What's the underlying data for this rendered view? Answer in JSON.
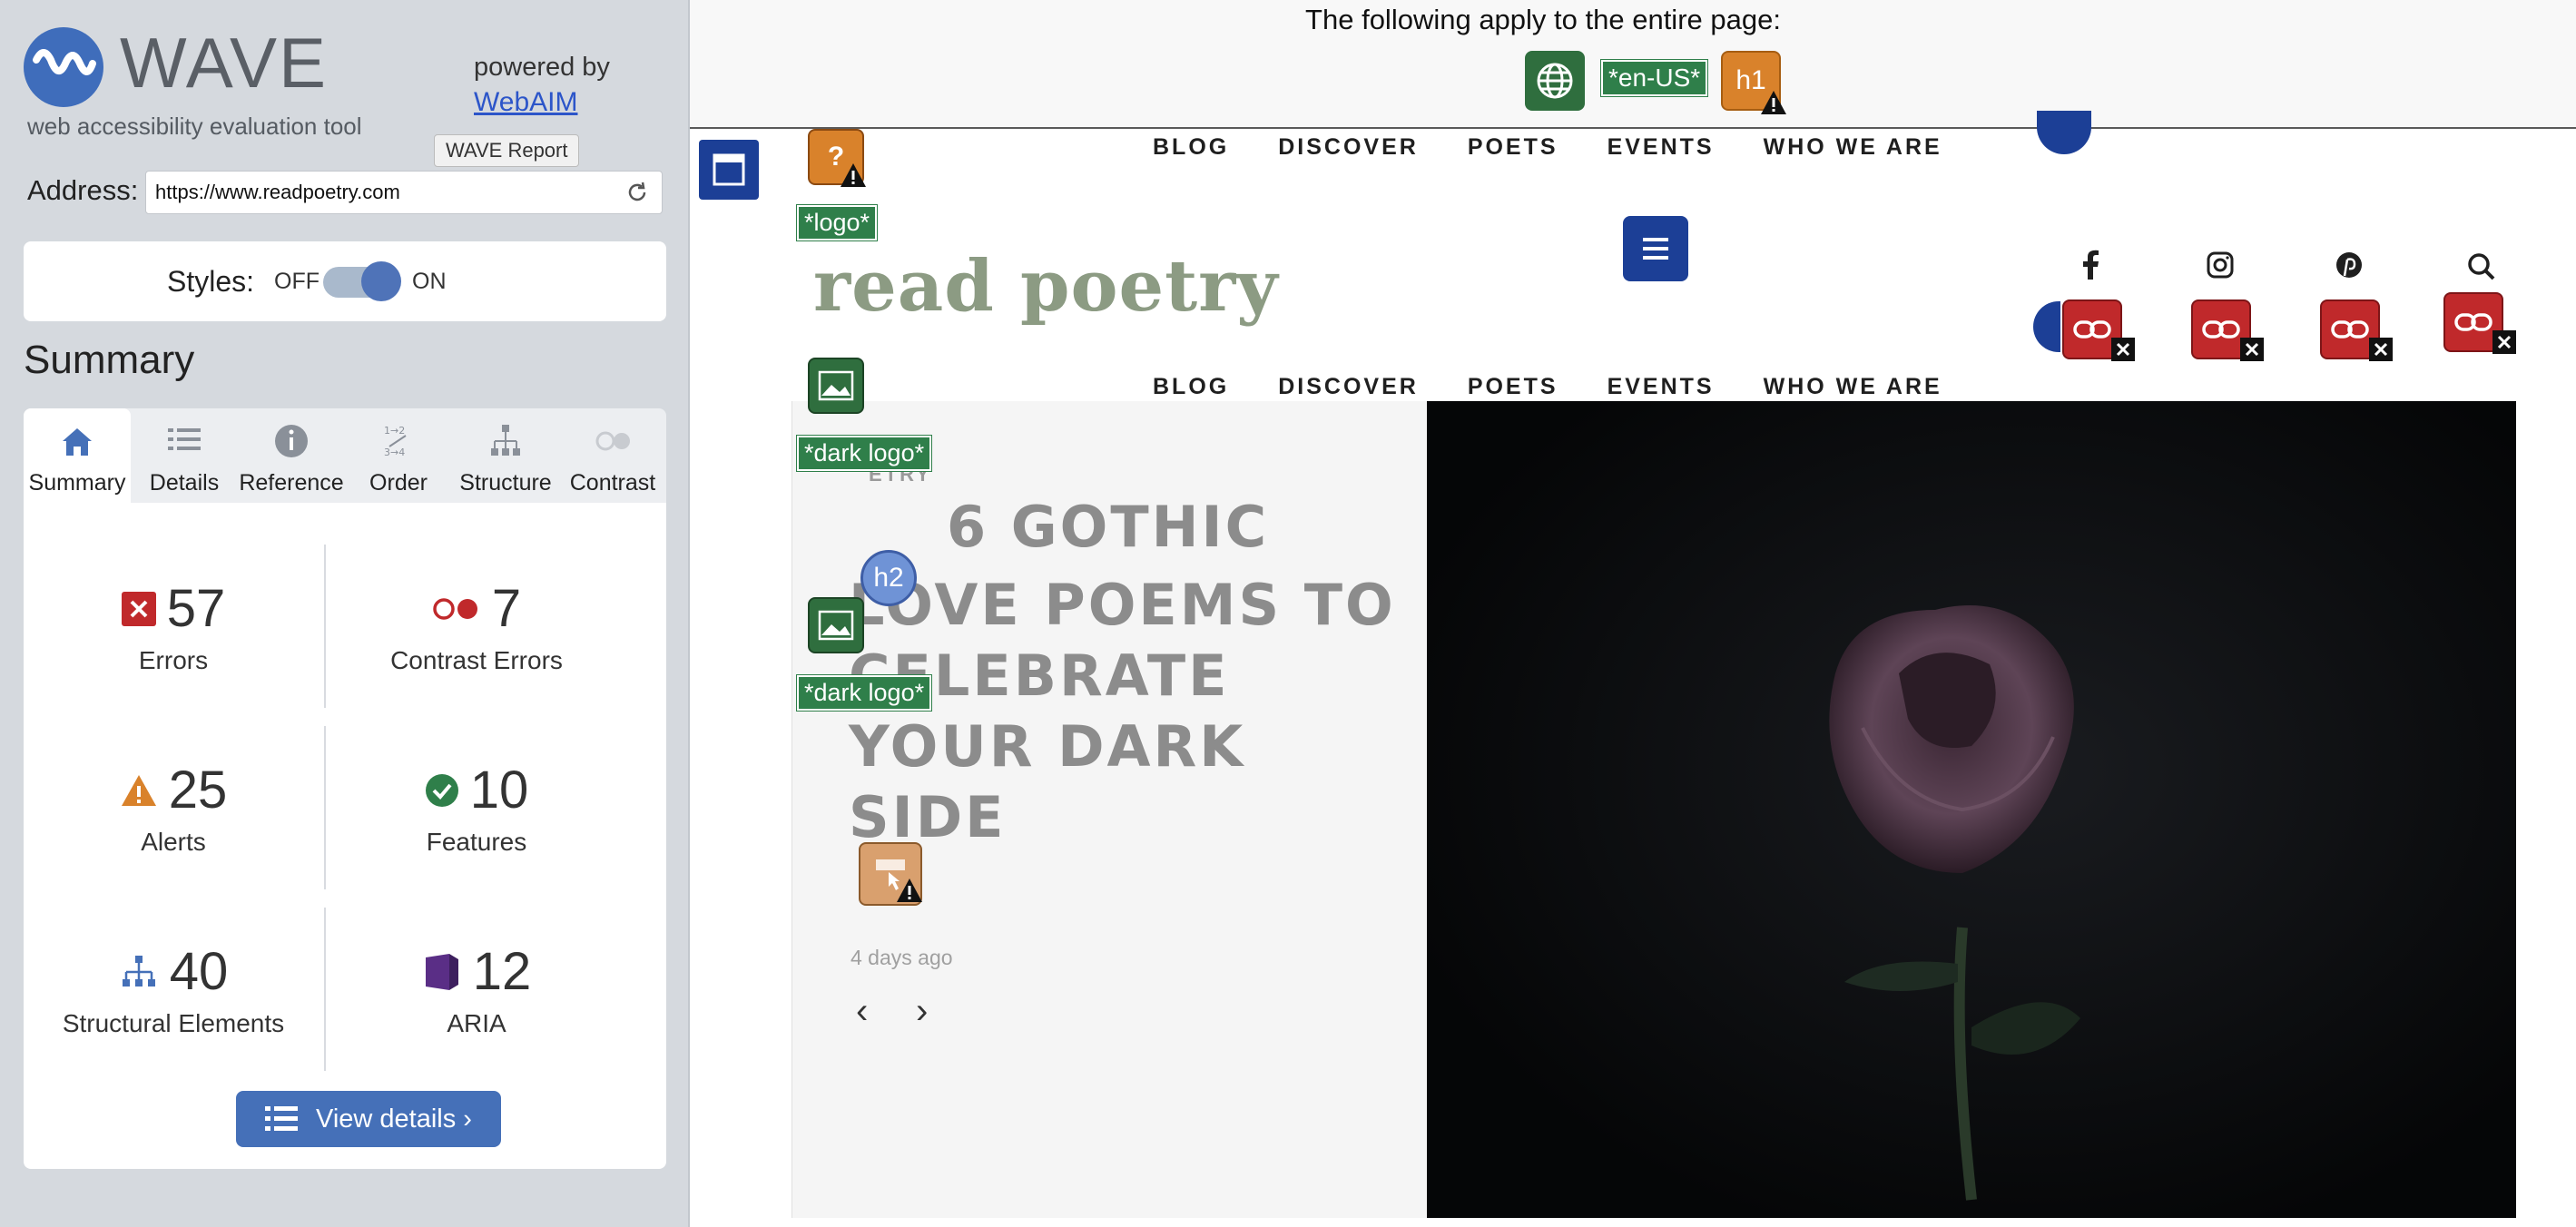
{
  "wave": {
    "logo_word": "WAVE",
    "tagline": "web accessibility evaluation tool",
    "powered_by": "powered by",
    "webaim_link": "WebAIM",
    "tooltip": "WAVE Report",
    "address_label": "Address:",
    "address_value": "https://www.readpoetry.com",
    "styles_label": "Styles:",
    "styles_off": "OFF",
    "styles_on": "ON",
    "summary_heading": "Summary",
    "tabs": [
      {
        "label": "Summary",
        "icon": "home-icon",
        "active": true
      },
      {
        "label": "Details",
        "icon": "list-icon"
      },
      {
        "label": "Reference",
        "icon": "info-icon"
      },
      {
        "label": "Order",
        "icon": "order-icon"
      },
      {
        "label": "Structure",
        "icon": "structure-icon"
      },
      {
        "label": "Contrast",
        "icon": "contrast-icon"
      }
    ],
    "stats": {
      "errors": {
        "value": "57",
        "label": "Errors"
      },
      "contrast": {
        "value": "7",
        "label": "Contrast Errors"
      },
      "alerts": {
        "value": "25",
        "label": "Alerts"
      },
      "features": {
        "value": "10",
        "label": "Features"
      },
      "structural": {
        "value": "40",
        "label": "Structural Elements"
      },
      "aria": {
        "value": "12",
        "label": "ARIA"
      }
    },
    "view_details": "View details ›"
  },
  "topbar": {
    "apply_text": "The following apply to the entire page:",
    "lang_tag": "*en-US*",
    "h1_tag": "h1"
  },
  "site": {
    "nav": [
      "BLOG",
      "DISCOVER",
      "POETS",
      "EVENTS",
      "WHO WE ARE"
    ],
    "title": "read poetry",
    "category_partial": "ETRY",
    "headline": [
      "6 GOTHIC",
      "LOVE POEMS TO",
      "CELEBRATE",
      "YOUR DARK SIDE"
    ],
    "date": "4 days ago",
    "prev_arrow": "‹",
    "next_arrow": "›"
  },
  "overlays": {
    "logo_tag": "*logo*",
    "dark_logo_tag_1": "*dark logo*",
    "dark_logo_tag_2": "*dark logo*",
    "h2_tag": "h2",
    "unknown_alert": "?"
  },
  "colors": {
    "wave_blue": "#3f6dbb",
    "error_red": "#c0292b",
    "alert_orange": "#d9822b",
    "feature_green": "#2f7f4a",
    "aria_purple": "#5a2e86",
    "site_title_green": "#8c9b83"
  }
}
